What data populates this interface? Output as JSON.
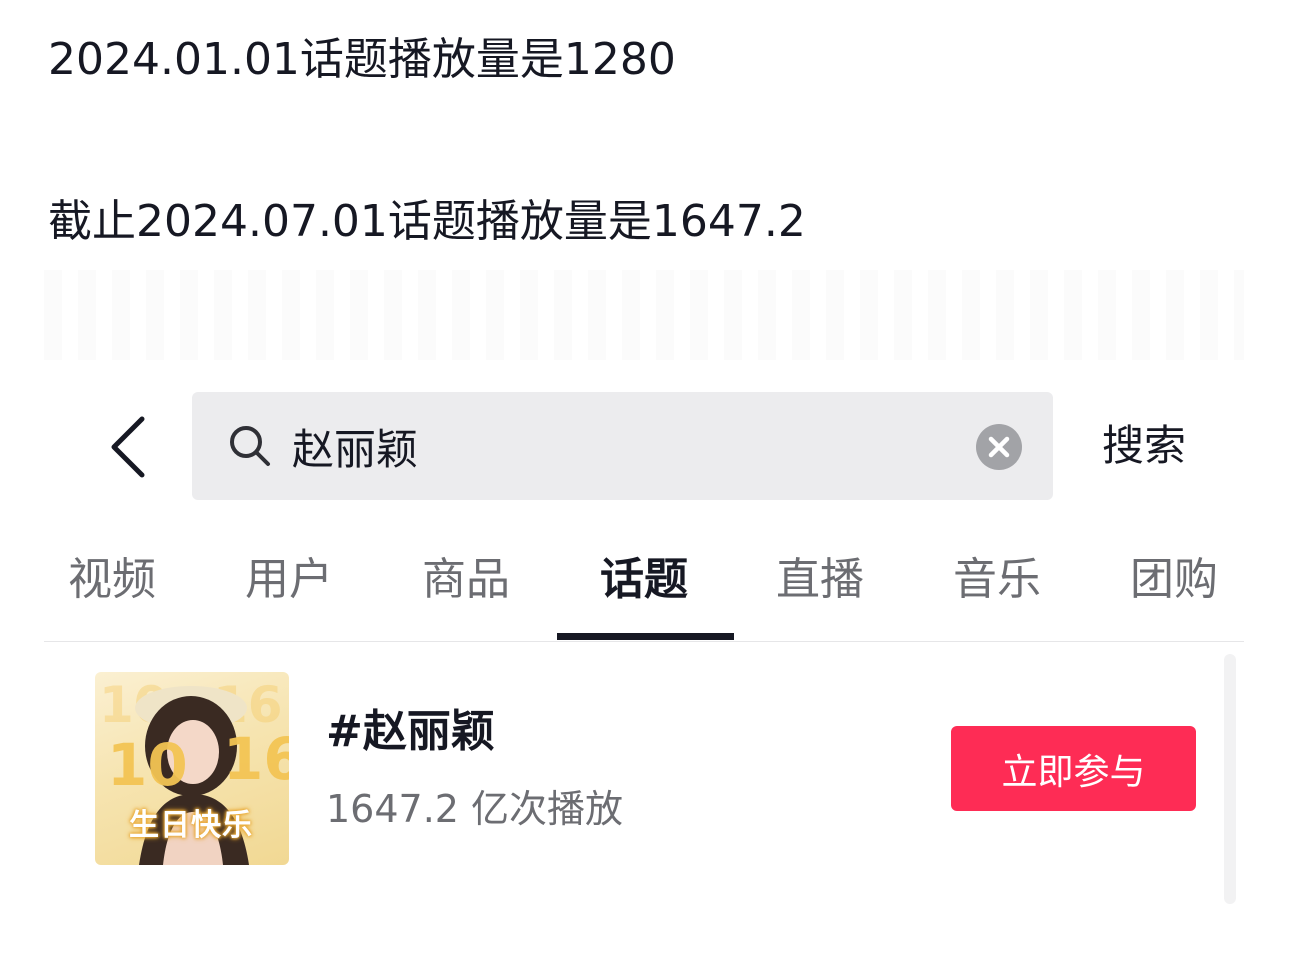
{
  "notes": [
    "2024.01.01话题播放量是1280",
    "截止2024.07.01话题播放量是1647.2"
  ],
  "search": {
    "query": "赵丽颖",
    "action_label": "搜索"
  },
  "tabs": [
    {
      "label": "视频",
      "active": false
    },
    {
      "label": "用户",
      "active": false
    },
    {
      "label": "商品",
      "active": false
    },
    {
      "label": "话题",
      "active": true
    },
    {
      "label": "直播",
      "active": false
    },
    {
      "label": "音乐",
      "active": false
    },
    {
      "label": "团购",
      "active": false
    }
  ],
  "result": {
    "title": "#赵丽颖",
    "views": "1647.2 亿次播放",
    "join_label": "立即参与",
    "thumbnail": {
      "numbers": [
        "10",
        "16"
      ],
      "caption": "生日快乐"
    }
  },
  "colors": {
    "accent": "#fe2c55",
    "text_primary": "#161823",
    "text_secondary": "#6c6d72",
    "search_bg": "#ececee"
  }
}
